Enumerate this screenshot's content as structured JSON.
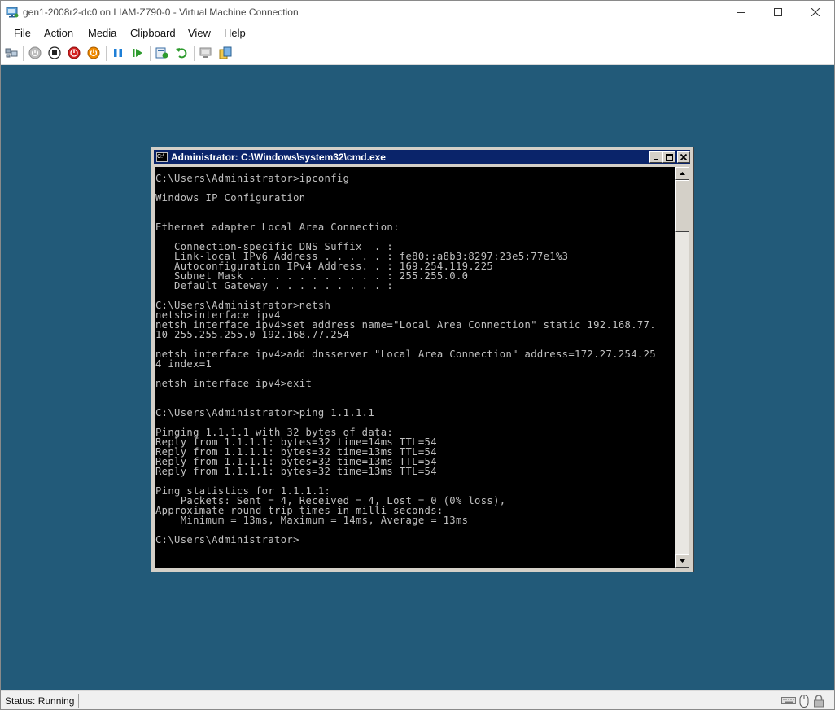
{
  "window": {
    "title": "gen1-2008r2-dc0 on LIAM-Z790-0 - Virtual Machine Connection",
    "icon": "vm-connection-icon",
    "controls": [
      "minimize-icon",
      "maximize-icon",
      "close-icon"
    ]
  },
  "menubar": {
    "items": [
      {
        "label": "File"
      },
      {
        "label": "Action"
      },
      {
        "label": "Media"
      },
      {
        "label": "Clipboard"
      },
      {
        "label": "View"
      },
      {
        "label": "Help"
      }
    ]
  },
  "toolbar": {
    "buttons": [
      "ctrl-alt-del-icon",
      "start-icon",
      "turn-off-icon",
      "shut-down-icon",
      "save-icon",
      "pause-icon",
      "resume-icon",
      "checkpoint-icon",
      "revert-icon",
      "enhanced-session-icon",
      "share-icon"
    ]
  },
  "guest": {
    "background_color": "#225a79",
    "cmd_window": {
      "title": "Administrator: C:\\Windows\\system32\\cmd.exe",
      "icon_text": "C:\\",
      "lines": [
        "C:\\Users\\Administrator>ipconfig",
        "",
        "Windows IP Configuration",
        "",
        "",
        "Ethernet adapter Local Area Connection:",
        "",
        "   Connection-specific DNS Suffix  . :",
        "   Link-local IPv6 Address . . . . . : fe80::a8b3:8297:23e5:77e1%3",
        "   Autoconfiguration IPv4 Address. . : 169.254.119.225",
        "   Subnet Mask . . . . . . . . . . . : 255.255.0.0",
        "   Default Gateway . . . . . . . . . :",
        "",
        "C:\\Users\\Administrator>netsh",
        "netsh>interface ipv4",
        "netsh interface ipv4>set address name=\"Local Area Connection\" static 192.168.77.",
        "10 255.255.255.0 192.168.77.254",
        "",
        "netsh interface ipv4>add dnsserver \"Local Area Connection\" address=172.27.254.25",
        "4 index=1",
        "",
        "netsh interface ipv4>exit",
        "",
        "",
        "C:\\Users\\Administrator>ping 1.1.1.1",
        "",
        "Pinging 1.1.1.1 with 32 bytes of data:",
        "Reply from 1.1.1.1: bytes=32 time=14ms TTL=54",
        "Reply from 1.1.1.1: bytes=32 time=13ms TTL=54",
        "Reply from 1.1.1.1: bytes=32 time=13ms TTL=54",
        "Reply from 1.1.1.1: bytes=32 time=13ms TTL=54",
        "",
        "Ping statistics for 1.1.1.1:",
        "    Packets: Sent = 4, Received = 4, Lost = 0 (0% loss),",
        "Approximate round trip times in milli-seconds:",
        "    Minimum = 13ms, Maximum = 14ms, Average = 13ms",
        "",
        "C:\\Users\\Administrator>"
      ]
    }
  },
  "statusbar": {
    "status": "Status: Running",
    "icons": [
      "keyboard-icon",
      "mouse-icon",
      "lock-icon"
    ]
  }
}
